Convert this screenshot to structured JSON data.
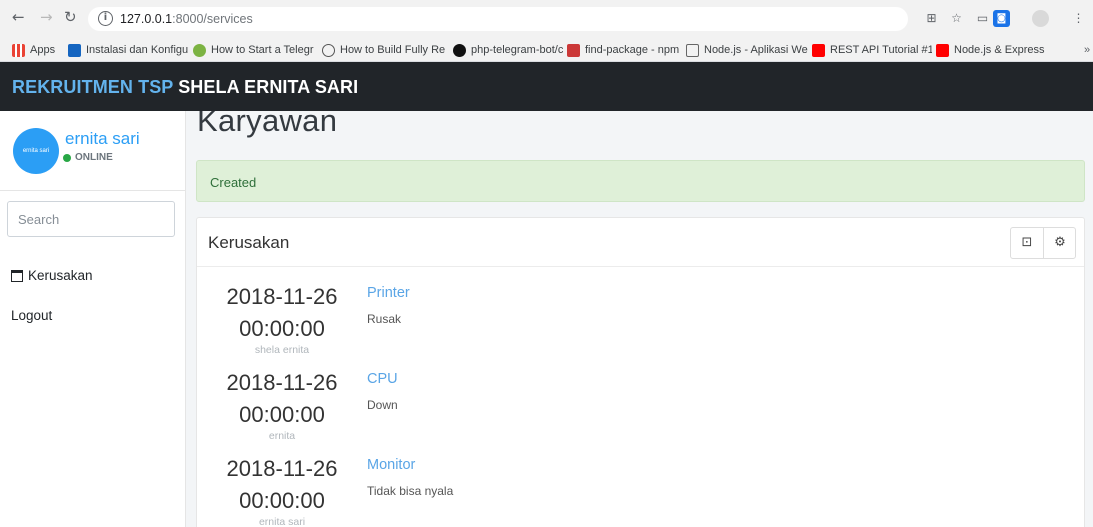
{
  "browser": {
    "url_host": "127.0.0.1",
    "url_path": ":8000/services",
    "bookmarks": [
      {
        "label": "Apps",
        "color": "#ea4335"
      },
      {
        "label": "Instalasi dan Konfigu",
        "color": "#1565c0"
      },
      {
        "label": "How to Start a Telegr",
        "color": "#7cb342"
      },
      {
        "label": "How to Build Fully Re",
        "color": "#555555"
      },
      {
        "label": "php-telegram-bot/co",
        "color": "#111111"
      },
      {
        "label": "find-package - npm",
        "color": "#cb3837"
      },
      {
        "label": "Node.js - Aplikasi We",
        "color": "#666666"
      },
      {
        "label": "REST API Tutorial #1",
        "color": "#ff0000"
      },
      {
        "label": "Node.js & Express Fr",
        "color": "#ff0000"
      }
    ]
  },
  "header": {
    "brand_prefix": "REKRUITMEN TSP",
    "brand_name": " SHELA ERNITA SARI"
  },
  "sidebar": {
    "avatar_text": "ernita sari",
    "user_name": "ernita sari",
    "status": "ONLINE",
    "search_placeholder": "Search",
    "items": [
      {
        "label": "Kerusakan"
      },
      {
        "label": "Logout"
      }
    ]
  },
  "main": {
    "page_title": "Karyawan",
    "alert": "Created",
    "card_title": "Kerusakan",
    "entries": [
      {
        "date": "2018-11-26",
        "time": "00:00:00",
        "user": "shela ernita",
        "title": "Printer",
        "desc": "Rusak"
      },
      {
        "date": "2018-11-26",
        "time": "00:00:00",
        "user": "ernita",
        "title": "CPU",
        "desc": "Down"
      },
      {
        "date": "2018-11-26",
        "time": "00:00:00",
        "user": "ernita sari",
        "title": "Monitor",
        "desc": "Tidak bisa nyala"
      }
    ]
  },
  "colors": {
    "accent": "#2b9ef5",
    "header_bg": "#212529",
    "alert_bg": "#dff0d8"
  }
}
